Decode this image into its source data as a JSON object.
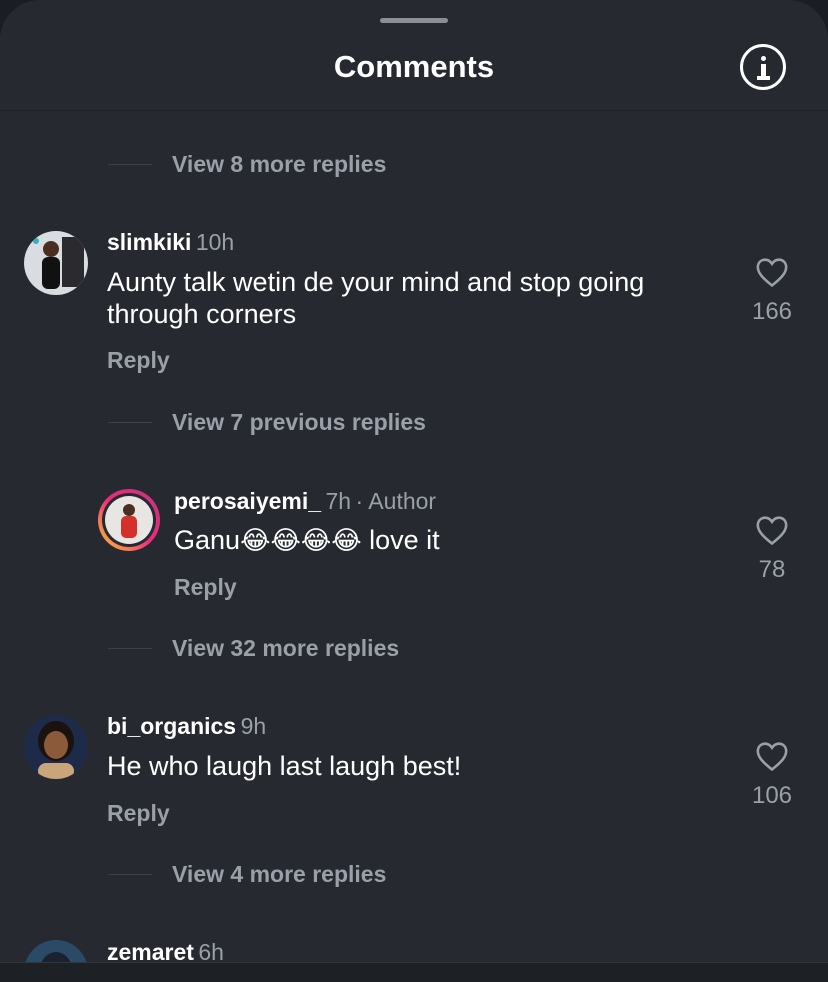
{
  "header": {
    "title": "Comments"
  },
  "view_more_top": "View 8 more replies",
  "comments": [
    {
      "username": "slimkiki",
      "time": "10h",
      "text": "Aunty talk wetin de your mind and stop going through corners",
      "reply": "Reply",
      "likes": "166",
      "view_replies": "View 7 previous replies"
    },
    {
      "username": "perosaiyemi_",
      "time": "7h",
      "author_tag": "· Author",
      "text_prefix": "Ganu",
      "emojis": "😂😂😂😂",
      "text_suffix": "love it",
      "reply": "Reply",
      "likes": "78",
      "view_replies": "View 32 more replies"
    },
    {
      "username": "bi_organics",
      "time": "9h",
      "text": "He who laugh last laugh best!",
      "reply": "Reply",
      "likes": "106",
      "view_replies": "View 4 more replies"
    },
    {
      "username": "zemaret",
      "time": "6h"
    }
  ],
  "colors": {
    "accent_ring_start": "#f9ce34",
    "accent_ring_mid": "#ee2a7b",
    "accent_ring_end": "#6228d7"
  }
}
